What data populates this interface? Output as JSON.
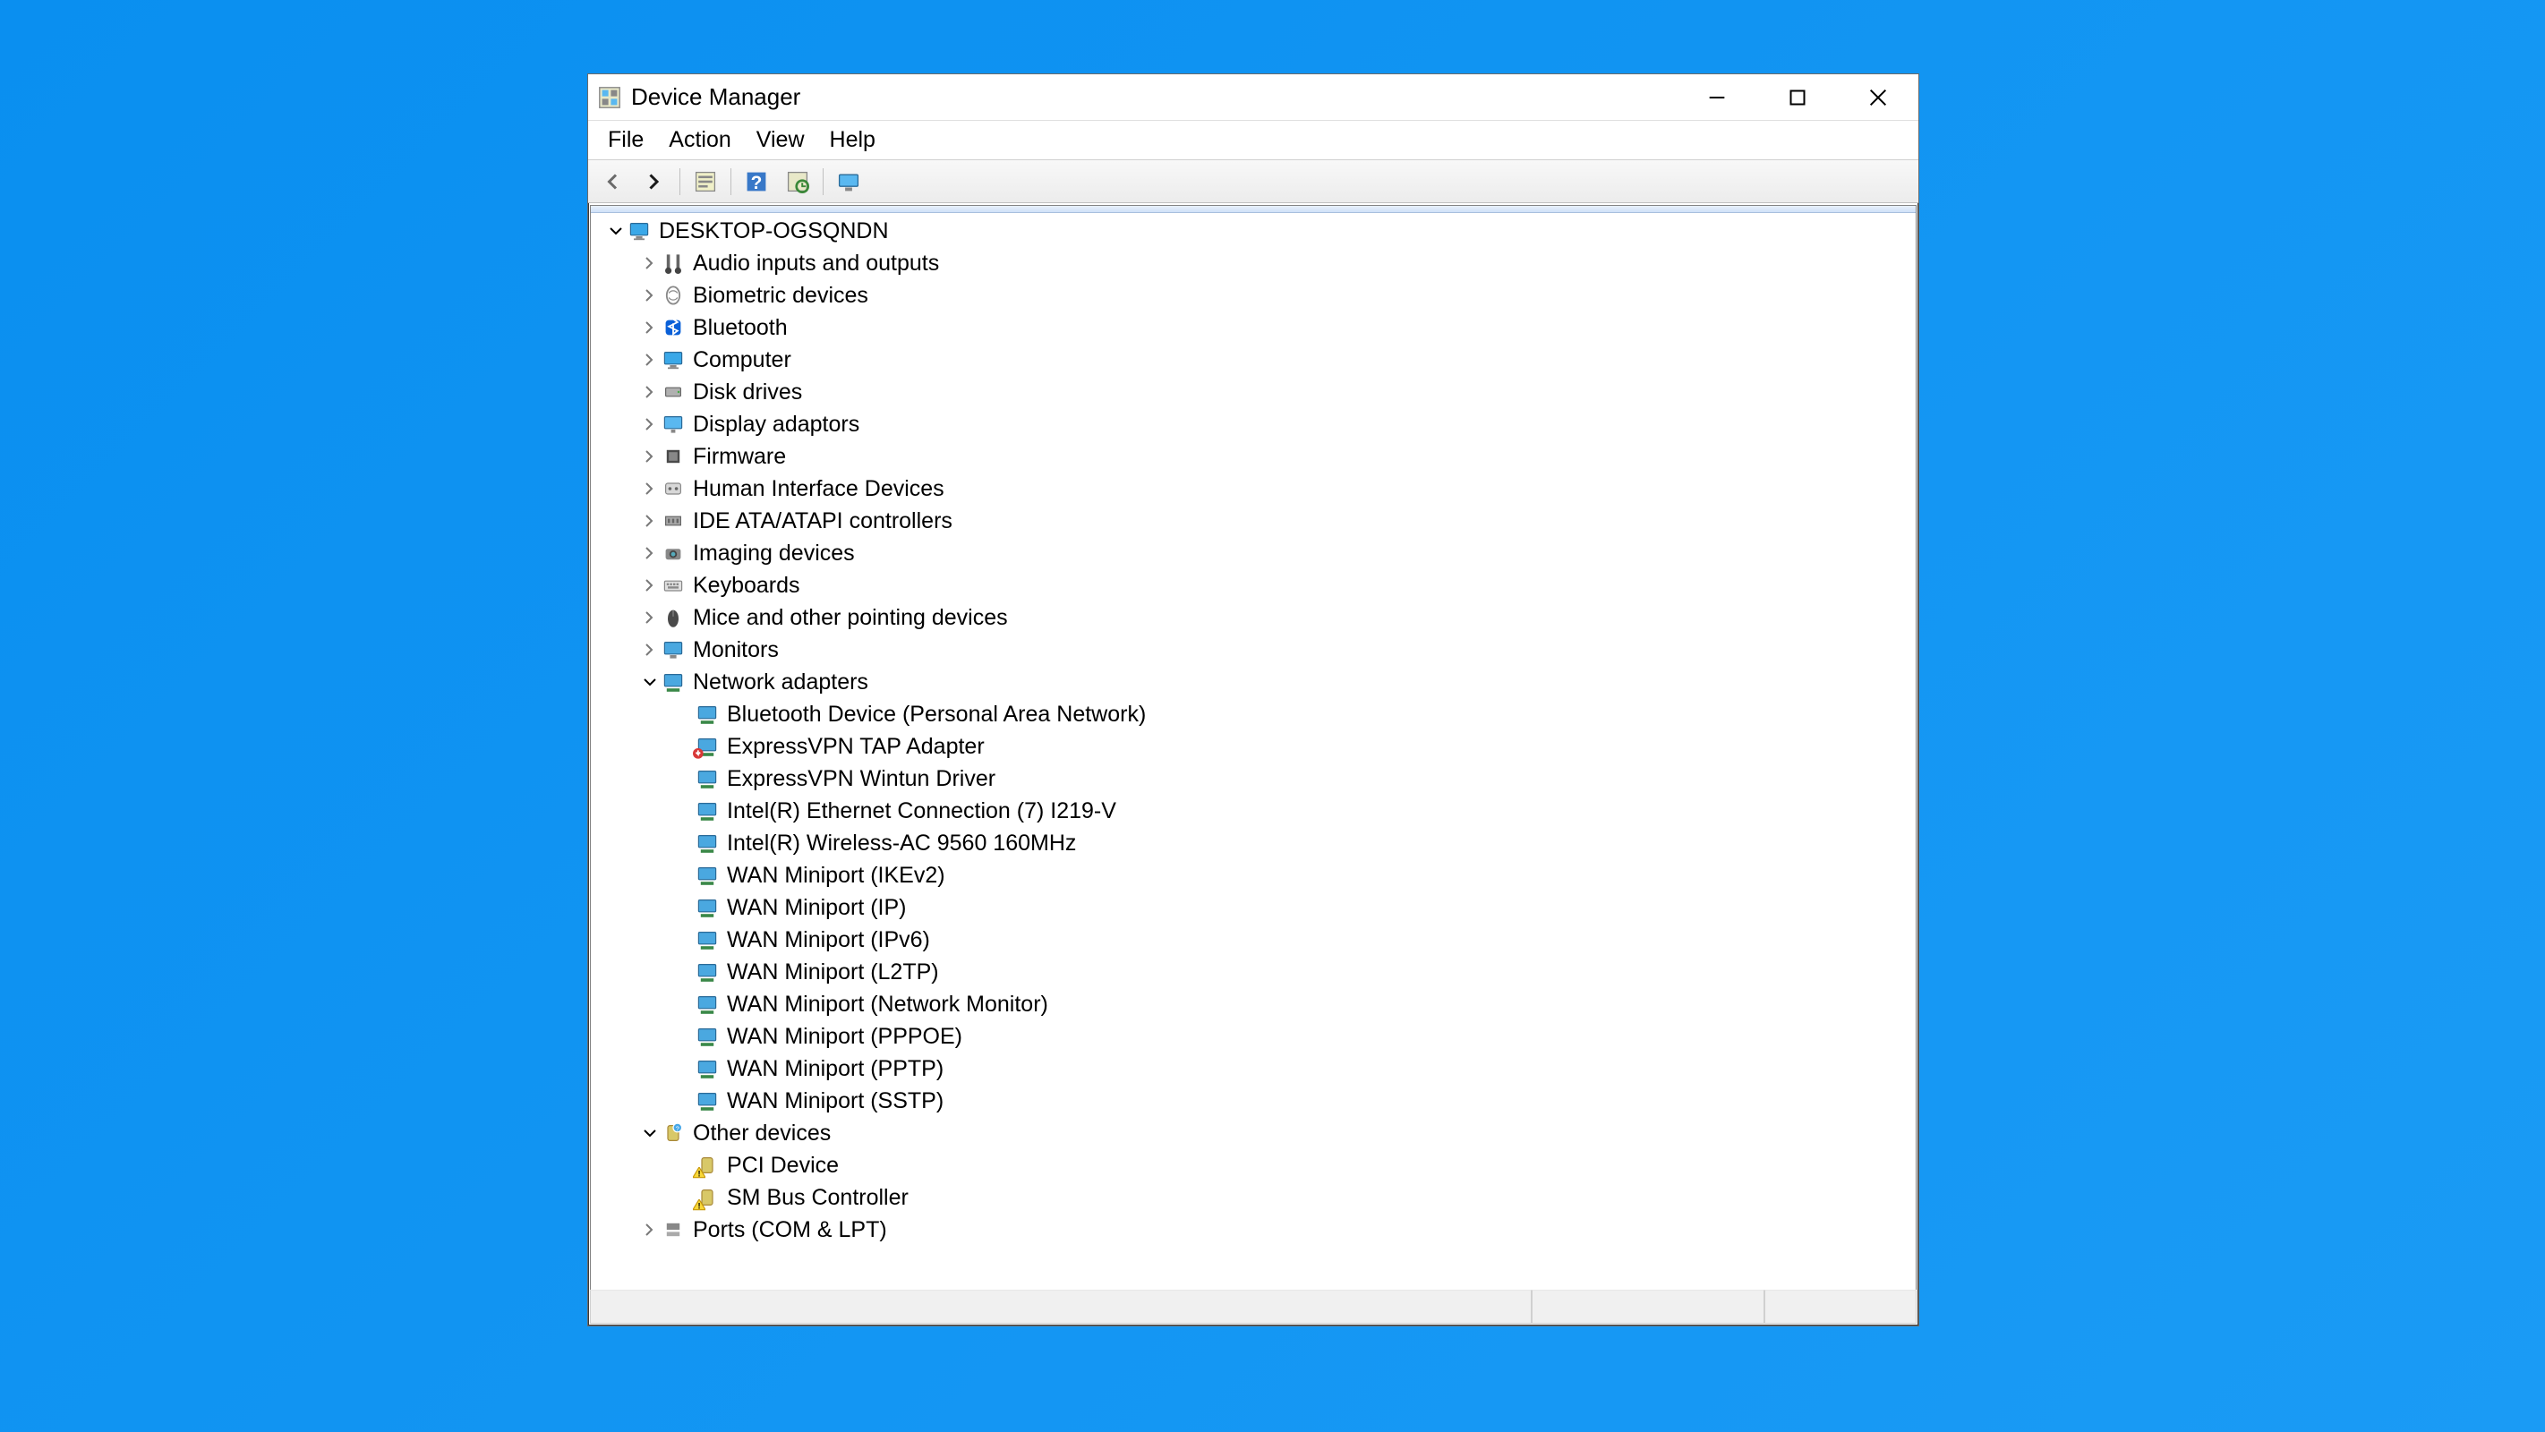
{
  "window": {
    "title": "Device Manager"
  },
  "menu": {
    "items": [
      "File",
      "Action",
      "View",
      "Help"
    ]
  },
  "toolbar": {
    "back": "Back",
    "forward": "Forward",
    "properties": "Properties",
    "help": "Help",
    "scan": "Scan for hardware changes",
    "show": "Show hidden devices"
  },
  "tree": {
    "root": {
      "label": "DESKTOP-OGSQNDN",
      "expanded": true,
      "icon": "computer"
    },
    "categories": [
      {
        "label": "Audio inputs and outputs",
        "expanded": false,
        "icon": "audio"
      },
      {
        "label": "Biometric devices",
        "expanded": false,
        "icon": "biometric"
      },
      {
        "label": "Bluetooth",
        "expanded": false,
        "icon": "bluetooth"
      },
      {
        "label": "Computer",
        "expanded": false,
        "icon": "computer"
      },
      {
        "label": "Disk drives",
        "expanded": false,
        "icon": "disk"
      },
      {
        "label": "Display adaptors",
        "expanded": false,
        "icon": "display"
      },
      {
        "label": "Firmware",
        "expanded": false,
        "icon": "firmware"
      },
      {
        "label": "Human Interface Devices",
        "expanded": false,
        "icon": "hid"
      },
      {
        "label": "IDE ATA/ATAPI controllers",
        "expanded": false,
        "icon": "ide"
      },
      {
        "label": "Imaging devices",
        "expanded": false,
        "icon": "imaging"
      },
      {
        "label": "Keyboards",
        "expanded": false,
        "icon": "keyboard"
      },
      {
        "label": "Mice and other pointing devices",
        "expanded": false,
        "icon": "mouse"
      },
      {
        "label": "Monitors",
        "expanded": false,
        "icon": "monitor"
      },
      {
        "label": "Network adapters",
        "expanded": true,
        "icon": "network",
        "children": [
          {
            "label": "Bluetooth Device (Personal Area Network)",
            "icon": "net",
            "overlay": null
          },
          {
            "label": "ExpressVPN TAP Adapter",
            "icon": "net",
            "overlay": "down"
          },
          {
            "label": "ExpressVPN Wintun Driver",
            "icon": "net",
            "overlay": null
          },
          {
            "label": "Intel(R) Ethernet Connection (7) I219-V",
            "icon": "net",
            "overlay": null
          },
          {
            "label": "Intel(R) Wireless-AC 9560 160MHz",
            "icon": "net",
            "overlay": null
          },
          {
            "label": "WAN Miniport (IKEv2)",
            "icon": "net",
            "overlay": null
          },
          {
            "label": "WAN Miniport (IP)",
            "icon": "net",
            "overlay": null
          },
          {
            "label": "WAN Miniport (IPv6)",
            "icon": "net",
            "overlay": null
          },
          {
            "label": "WAN Miniport (L2TP)",
            "icon": "net",
            "overlay": null
          },
          {
            "label": "WAN Miniport (Network Monitor)",
            "icon": "net",
            "overlay": null
          },
          {
            "label": "WAN Miniport (PPPOE)",
            "icon": "net",
            "overlay": null
          },
          {
            "label": "WAN Miniport (PPTP)",
            "icon": "net",
            "overlay": null
          },
          {
            "label": "WAN Miniport (SSTP)",
            "icon": "net",
            "overlay": null
          }
        ]
      },
      {
        "label": "Other devices",
        "expanded": true,
        "icon": "other",
        "children": [
          {
            "label": "PCI Device",
            "icon": "unknown",
            "overlay": "warning"
          },
          {
            "label": "SM Bus Controller",
            "icon": "unknown",
            "overlay": "warning"
          }
        ]
      },
      {
        "label": "Ports (COM & LPT)",
        "expanded": false,
        "icon": "ports"
      }
    ]
  }
}
